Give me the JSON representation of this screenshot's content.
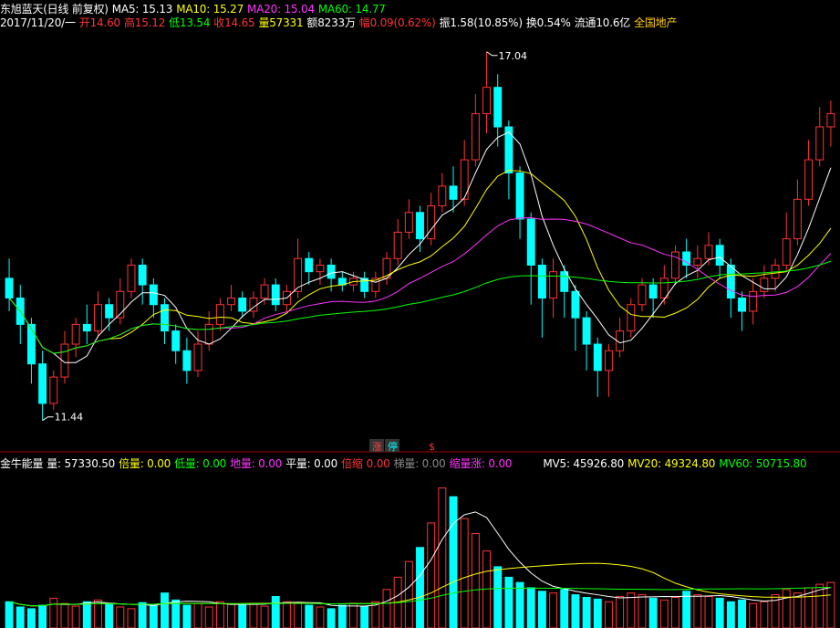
{
  "header": {
    "stock_title": "东旭蓝天(日线 前复权)",
    "ma5": "MA5: 15.13",
    "ma10": "MA10: 15.27",
    "ma20": "MA20: 15.04",
    "ma60": "MA60: 14.77"
  },
  "quote": {
    "date": "2017/11/20/一",
    "open": "开14.60",
    "high": "高15.12",
    "low": "低13.54",
    "close": "收14.65",
    "volume": "量57331",
    "amount": "额8233万",
    "change": "幅0.09(0.62%)",
    "amplitude": "振1.58(10.85%)",
    "turnover": "换0.54%",
    "float": "流通10.6亿",
    "sector": "全国地产"
  },
  "indicator": {
    "name": "金牛能量",
    "vol": "量: 57330.50",
    "bei": "倍量: 0.00",
    "di": "低量: 0.00",
    "ground": "地量: 0.00",
    "flat": "平量: 0.00",
    "shrink": "倍缩",
    "shrink_val": "0.00",
    "ladder": "梯量: 0.00",
    "shrink_rise": "缩量涨: 0.00",
    "mv5": "MV5: 45926.80",
    "mv20": "MV20: 49324.80",
    "mv60": "MV60: 50715.80"
  },
  "markers": {
    "limit_up_1": "涨",
    "limit_up_2": "停",
    "dollar": "$"
  },
  "chart_data": {
    "type": "candlestick",
    "price_annotations": {
      "high_label": "17.04",
      "low_label": "11.44"
    },
    "colors": {
      "up": "#ff3333",
      "down": "#00ffff",
      "ma5": "#ffffff",
      "ma10": "#ffff00",
      "ma20": "#ff33ff",
      "ma60": "#00ff00"
    },
    "price_range": [
      11.2,
      17.3
    ],
    "candles": [
      [
        13.6,
        13.3,
        13.9,
        13.1
      ],
      [
        13.3,
        12.9,
        13.5,
        12.6
      ],
      [
        12.9,
        12.3,
        13.0,
        12.0
      ],
      [
        12.3,
        11.7,
        12.5,
        11.44
      ],
      [
        11.7,
        12.1,
        12.2,
        11.6
      ],
      [
        12.1,
        12.6,
        12.8,
        12.0
      ],
      [
        12.6,
        12.9,
        13.0,
        12.4
      ],
      [
        12.9,
        12.8,
        13.2,
        12.6
      ],
      [
        12.8,
        13.2,
        13.4,
        12.7
      ],
      [
        13.2,
        13.0,
        13.3,
        12.8
      ],
      [
        13.0,
        13.4,
        13.6,
        12.9
      ],
      [
        13.4,
        13.8,
        13.9,
        13.3
      ],
      [
        13.8,
        13.5,
        13.9,
        13.2
      ],
      [
        13.5,
        13.2,
        13.6,
        13.0
      ],
      [
        13.2,
        12.8,
        13.3,
        12.6
      ],
      [
        12.8,
        12.5,
        12.9,
        12.3
      ],
      [
        12.5,
        12.2,
        12.7,
        12.0
      ],
      [
        12.2,
        12.6,
        12.8,
        12.1
      ],
      [
        12.6,
        12.9,
        13.1,
        12.5
      ],
      [
        12.9,
        13.2,
        13.3,
        12.8
      ],
      [
        13.2,
        13.3,
        13.5,
        13.1
      ],
      [
        13.3,
        13.1,
        13.4,
        13.0
      ],
      [
        13.1,
        13.3,
        13.4,
        13.0
      ],
      [
        13.3,
        13.5,
        13.6,
        13.2
      ],
      [
        13.5,
        13.2,
        13.6,
        13.1
      ],
      [
        13.2,
        13.4,
        13.5,
        13.1
      ],
      [
        13.4,
        13.9,
        14.2,
        13.3
      ],
      [
        13.9,
        13.7,
        14.0,
        13.5
      ],
      [
        13.7,
        13.8,
        13.9,
        13.5
      ],
      [
        13.8,
        13.6,
        13.9,
        13.4
      ],
      [
        13.6,
        13.5,
        13.7,
        13.4
      ],
      [
        13.5,
        13.6,
        13.7,
        13.4
      ],
      [
        13.6,
        13.4,
        13.7,
        13.3
      ],
      [
        13.4,
        13.6,
        13.7,
        13.3
      ],
      [
        13.6,
        13.9,
        14.0,
        13.5
      ],
      [
        13.9,
        14.3,
        14.5,
        13.8
      ],
      [
        14.3,
        14.6,
        14.8,
        14.2
      ],
      [
        14.6,
        14.2,
        14.7,
        14.0
      ],
      [
        14.2,
        14.7,
        14.9,
        14.1
      ],
      [
        14.7,
        15.0,
        15.2,
        14.6
      ],
      [
        15.0,
        14.8,
        15.3,
        14.6
      ],
      [
        14.8,
        15.4,
        15.7,
        14.7
      ],
      [
        15.4,
        16.1,
        16.4,
        15.3
      ],
      [
        16.1,
        16.5,
        17.04,
        15.8
      ],
      [
        16.5,
        15.9,
        16.7,
        15.6
      ],
      [
        15.9,
        15.2,
        16.0,
        14.8
      ],
      [
        15.2,
        14.5,
        15.3,
        14.2
      ],
      [
        14.5,
        13.8,
        14.6,
        13.2
      ],
      [
        13.8,
        13.3,
        13.9,
        12.7
      ],
      [
        13.3,
        13.7,
        13.9,
        13.0
      ],
      [
        13.7,
        13.4,
        13.8,
        13.0
      ],
      [
        13.4,
        13.0,
        13.5,
        12.5
      ],
      [
        13.0,
        12.6,
        13.1,
        12.2
      ],
      [
        12.6,
        12.2,
        12.7,
        11.8
      ],
      [
        12.2,
        12.5,
        12.6,
        11.8
      ],
      [
        12.5,
        12.8,
        13.0,
        12.4
      ],
      [
        12.8,
        13.2,
        13.3,
        12.7
      ],
      [
        13.2,
        13.5,
        13.6,
        13.1
      ],
      [
        13.5,
        13.3,
        13.6,
        13.0
      ],
      [
        13.3,
        13.6,
        13.8,
        13.2
      ],
      [
        13.6,
        14.0,
        14.1,
        13.5
      ],
      [
        14.0,
        13.8,
        14.2,
        13.6
      ],
      [
        13.8,
        13.9,
        14.1,
        13.6
      ],
      [
        13.9,
        14.1,
        14.3,
        13.8
      ],
      [
        14.1,
        13.8,
        14.2,
        13.6
      ],
      [
        13.8,
        13.3,
        13.9,
        13.0
      ],
      [
        13.3,
        13.1,
        13.4,
        12.8
      ],
      [
        13.1,
        13.4,
        13.6,
        12.9
      ],
      [
        13.4,
        13.6,
        13.8,
        13.3
      ],
      [
        13.6,
        13.8,
        13.9,
        13.4
      ],
      [
        13.8,
        14.2,
        14.6,
        13.7
      ],
      [
        14.2,
        14.8,
        15.1,
        14.1
      ],
      [
        14.8,
        15.4,
        15.7,
        14.7
      ],
      [
        15.4,
        15.9,
        16.2,
        15.3
      ],
      [
        15.9,
        16.1,
        16.3,
        15.6
      ]
    ],
    "volume_range": [
      0,
      170000
    ],
    "volumes": [
      30,
      24,
      22,
      26,
      34,
      28,
      25,
      30,
      32,
      27,
      24,
      22,
      29,
      26,
      40,
      32,
      26,
      28,
      24,
      30,
      27,
      26,
      28,
      25,
      36,
      30,
      28,
      26,
      24,
      22,
      26,
      28,
      25,
      30,
      44,
      58,
      76,
      92,
      120,
      160,
      150,
      125,
      108,
      88,
      70,
      58,
      52,
      46,
      42,
      40,
      44,
      38,
      35,
      33,
      30,
      36,
      40,
      38,
      34,
      32,
      35,
      42,
      38,
      36,
      34,
      30,
      32,
      28,
      30,
      38,
      44,
      40,
      46,
      50,
      52
    ],
    "mv_lines": {
      "MV5": "#ffffff",
      "MV20": "#ffff00",
      "MV60": "#00ff00"
    }
  }
}
